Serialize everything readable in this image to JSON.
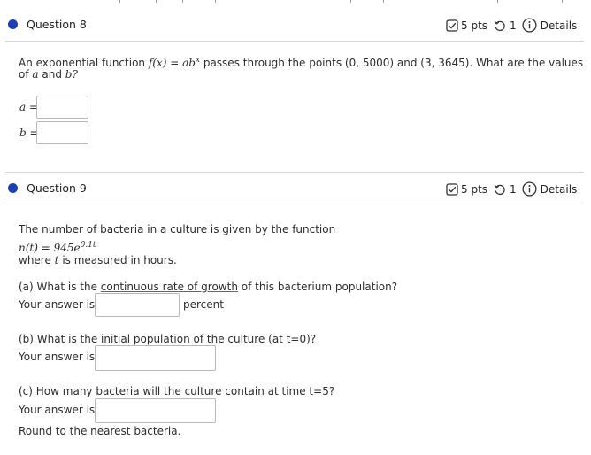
{
  "q8": {
    "title": "Question 8",
    "points": "5 pts",
    "retries": "1",
    "details": "Details",
    "prompt_pre": "An exponential function ",
    "fx": "f(x) = ab",
    "fx_exp": "x",
    "prompt_mid": " passes through the points (0, 5000) and (3, 3645). What are the values",
    "prompt_of": "of ",
    "var_a": "a",
    "and": " and ",
    "var_b": "b?",
    "a_label": "a =",
    "b_label": "b =",
    "a_value": "",
    "b_value": ""
  },
  "q9": {
    "title": "Question 9",
    "points": "5 pts",
    "retries": "1",
    "details": "Details",
    "intro": "The number of bacteria in a culture is given by the function",
    "formula_left": "n(t) = 945e",
    "formula_exp": "0.1t",
    "where_pre": "where ",
    "where_var": "t",
    "where_post": " is measured in hours.",
    "part_a_pre": "(a) What is the ",
    "part_a_link": "continuous rate of growth",
    "part_a_post": " of this bacterium population?",
    "answer_label": "Your answer is",
    "percent": "percent",
    "part_b": "(b) What is the initial population of the culture (at t=0)?",
    "part_c": "(c) How many bacteria will the culture contain at time t=5?",
    "round_note": "Round to the nearest bacteria.",
    "a_value": "",
    "b_value": "",
    "c_value": ""
  },
  "colors": {
    "dot": "#1c3fb3",
    "border": "#b9b9b9",
    "rule": "#d6d6d6"
  },
  "icons": [
    "checkbox-pts-icon",
    "retry-icon",
    "info-icon"
  ]
}
